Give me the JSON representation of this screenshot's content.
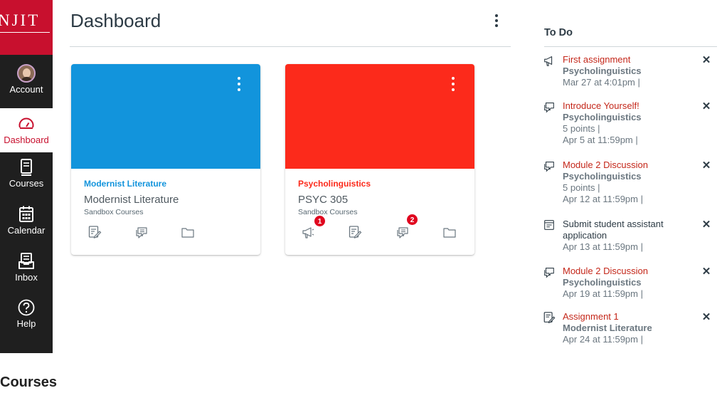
{
  "brand": {
    "logo_text": "NJIT",
    "color": "#c8102e"
  },
  "nav": {
    "items": [
      {
        "label": "Account",
        "icon": "avatar"
      },
      {
        "label": "Dashboard",
        "icon": "speedometer-icon",
        "active": true
      },
      {
        "label": "Courses",
        "icon": "book-icon"
      },
      {
        "label": "Calendar",
        "icon": "calendar-icon"
      },
      {
        "label": "Inbox",
        "icon": "inbox-icon"
      },
      {
        "label": "Help",
        "icon": "help-icon"
      }
    ]
  },
  "header": {
    "title": "Dashboard"
  },
  "cards": [
    {
      "color": "#1294dc",
      "name": "Modernist Literature",
      "code": "Modernist Literature",
      "term": "Sandbox Courses",
      "icons": [
        "assignments-icon",
        "discussions-icon",
        "files-icon"
      ]
    },
    {
      "color": "#fc2a1b",
      "name": "Psycholinguistics",
      "code": "PSYC 305",
      "term": "Sandbox Courses",
      "icons": [
        "announcements-icon",
        "assignments-icon",
        "discussions-icon",
        "files-icon"
      ],
      "badges": {
        "announcements": "1",
        "discussions": "2"
      }
    }
  ],
  "todo": {
    "title": "To Do",
    "items": [
      {
        "icon": "announcement-icon",
        "title": "First assignment",
        "course": "Psycholinguistics",
        "meta": [
          "Mar 27 at 4:01pm  |"
        ]
      },
      {
        "icon": "discussion-icon",
        "title": "Introduce Yourself!",
        "course": "Psycholinguistics",
        "meta": [
          "5 points  |",
          "Apr 5 at 11:59pm  |"
        ]
      },
      {
        "icon": "discussion-icon",
        "title": "Module 2 Discussion",
        "course": "Psycholinguistics",
        "meta": [
          "5 points  |",
          "Apr 12 at 11:59pm  |"
        ]
      },
      {
        "icon": "planner-note-icon",
        "title": "Submit student assistant application",
        "meta": [
          "Apr 13 at 11:59pm  |"
        ]
      },
      {
        "icon": "discussion-icon",
        "title": "Module 2 Discussion",
        "course": "Psycholinguistics",
        "meta": [
          "Apr 19 at 11:59pm  |"
        ]
      },
      {
        "icon": "assignment-icon",
        "title": "Assignment 1",
        "course": "Modernist Literature",
        "meta": [
          "Apr 24 at 11:59pm  |"
        ]
      }
    ],
    "dismiss_glyph": "✕"
  },
  "footer": {
    "heading": "Courses"
  }
}
